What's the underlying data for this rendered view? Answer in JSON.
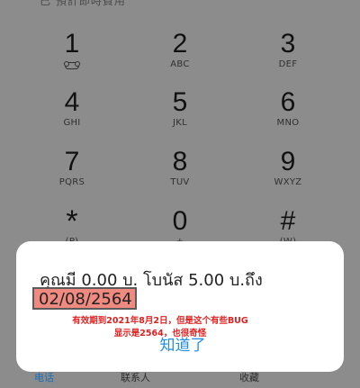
{
  "top_status_blur": "已 預計即時費用",
  "keypad": [
    {
      "digit": "1",
      "letters": "",
      "icon": "voicemail-icon"
    },
    {
      "digit": "2",
      "letters": "ABC"
    },
    {
      "digit": "3",
      "letters": "DEF"
    },
    {
      "digit": "4",
      "letters": "GHI"
    },
    {
      "digit": "5",
      "letters": "JKL"
    },
    {
      "digit": "6",
      "letters": "MNO"
    },
    {
      "digit": "7",
      "letters": "PQRS"
    },
    {
      "digit": "8",
      "letters": "TUV"
    },
    {
      "digit": "9",
      "letters": "WXYZ"
    },
    {
      "digit": "*",
      "letters": "(P)"
    },
    {
      "digit": "0",
      "letters": "+"
    },
    {
      "digit": "#",
      "letters": "(W)"
    }
  ],
  "bottom_tabs": [
    "电话",
    "联系人",
    "收藏"
  ],
  "dialog": {
    "message": "คุณมี 0.00 บ. โบนัส 5.00 บ.ถึง",
    "date": "02/08/2564",
    "annotation_line1": "有效期到2021年8月2日，但是这个有些BUG",
    "annotation_line2": "显示是2564，也很奇怪",
    "ok_label": "知道了"
  },
  "colors": {
    "dim_background": "#8c8c8c",
    "highlight_fill": "#ee8a80",
    "annotation_red": "#e02020",
    "ok_blue": "#1f8fe6"
  }
}
